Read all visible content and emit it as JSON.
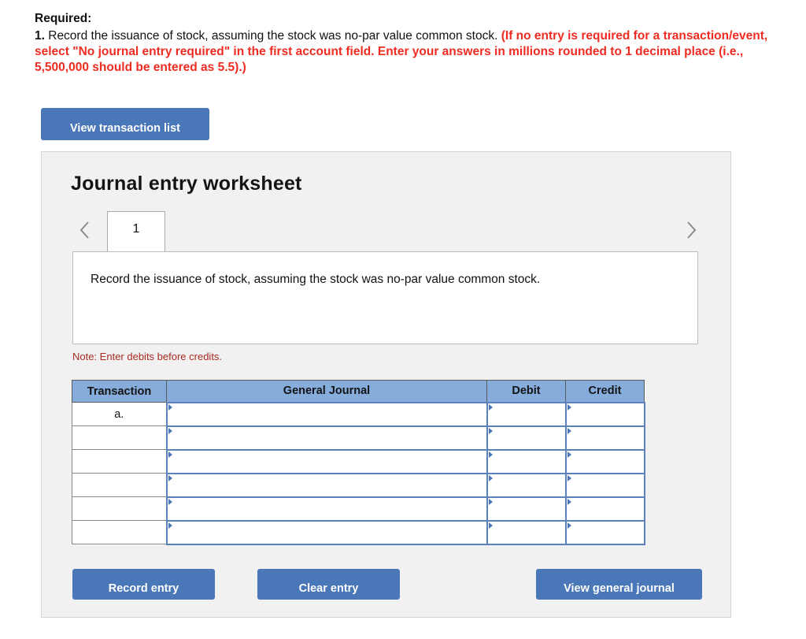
{
  "required": {
    "label": "Required:",
    "item_number": "1.",
    "item_text": " Record the issuance of stock, assuming the stock was no-par value common stock. ",
    "parenthetical": "(If no entry is required for a transaction/event, select \"No journal entry required\" in the first account field. Enter your answers in millions rounded to 1 decimal place (i.e., 5,500,000 should be entered as 5.5).)",
    "red_color": "#ef2b22"
  },
  "toolbar": {
    "view_transaction_list_label": "View transaction list"
  },
  "worksheet": {
    "title": "Journal entry worksheet",
    "tabs": [
      {
        "label": "1",
        "active": true
      }
    ],
    "prev_icon": "chevron-left-icon",
    "next_icon": "chevron-right-icon",
    "scenario_text": "Record the issuance of stock, assuming the stock was no-par value common stock.",
    "note": "Note: Enter debits before credits.",
    "note_color": "#a82b23"
  },
  "table": {
    "headers": [
      "Transaction",
      "General Journal",
      "Debit",
      "Credit"
    ],
    "header_bg": "#85acdb",
    "rows": [
      {
        "transaction": "a.",
        "general_journal": "",
        "debit": "",
        "credit": ""
      },
      {
        "transaction": "",
        "general_journal": "",
        "debit": "",
        "credit": ""
      },
      {
        "transaction": "",
        "general_journal": "",
        "debit": "",
        "credit": ""
      },
      {
        "transaction": "",
        "general_journal": "",
        "debit": "",
        "credit": ""
      },
      {
        "transaction": "",
        "general_journal": "",
        "debit": "",
        "credit": ""
      },
      {
        "transaction": "",
        "general_journal": "",
        "debit": "",
        "credit": ""
      }
    ]
  },
  "actions": {
    "record_entry_label": "Record entry",
    "clear_entry_label": "Clear entry",
    "view_general_journal_label": "View general journal",
    "button_color": "#4a77b8"
  }
}
